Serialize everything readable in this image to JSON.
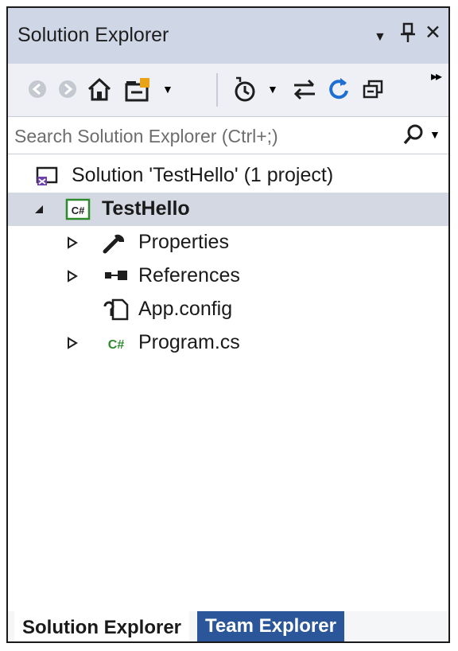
{
  "window": {
    "title": "Solution Explorer",
    "controls": {
      "dropdown_icon": "▼",
      "pin_icon": "⊥",
      "close_icon": "✕"
    }
  },
  "search": {
    "placeholder": "Search Solution Explorer (Ctrl+;)"
  },
  "tree": {
    "solution": {
      "label": "Solution 'TestHello' (1 project)",
      "icon": "solution-icon"
    },
    "project": {
      "label": "TestHello",
      "icon": "csharp-project-icon",
      "expanded": true,
      "selected": true
    },
    "children": [
      {
        "label": "Properties",
        "icon": "wrench-icon",
        "expandable": true
      },
      {
        "label": "References",
        "icon": "references-icon",
        "expandable": true
      },
      {
        "label": "App.config",
        "icon": "config-file-icon",
        "expandable": false
      },
      {
        "label": "Program.cs",
        "icon": "csharp-file-icon",
        "expandable": true
      }
    ]
  },
  "tabs": [
    {
      "label": "Solution Explorer",
      "active": true
    },
    {
      "label": "Team Explorer",
      "active": false
    }
  ],
  "colors": {
    "titlebar": "#cfd6e6",
    "selection": "#d4d8e2",
    "accent_blue": "#1e6fd1",
    "csharp_green": "#2c8a2c",
    "inactive_tab": "#2b579a"
  }
}
